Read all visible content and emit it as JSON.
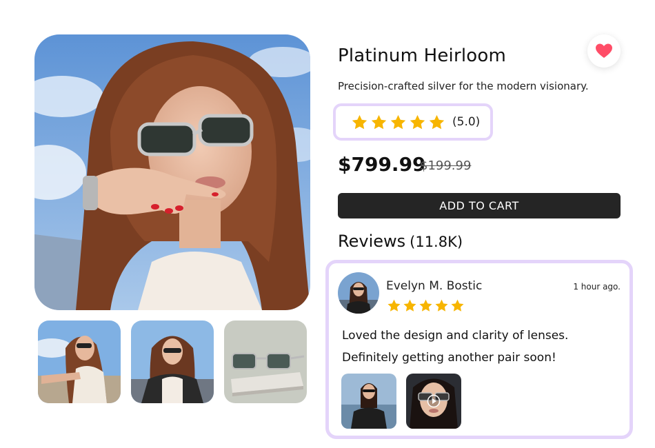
{
  "product": {
    "title": "Platinum Heirloom",
    "subtitle": "Precision-crafted silver for the modern visionary.",
    "rating": 5.0,
    "rating_label": "(5.0)",
    "price": "$799.99",
    "original_price": "$199.99",
    "add_to_cart_label": "ADD TO CART",
    "favorite_icon": "heart-icon"
  },
  "reviews": {
    "heading": "Reviews",
    "count_label": "(11.8K)",
    "items": [
      {
        "name": "Evelyn M. Bostic",
        "time": "1 hour ago.",
        "stars": 5,
        "text_line_1": "Loved the design and clarity of lenses.",
        "text_line_2": "Definitely getting another pair soon!",
        "media_icons": [
          "play-icon"
        ]
      }
    ]
  },
  "colors": {
    "accent_border": "#e4d4fa",
    "star": "#f7b500",
    "heart": "#ff4d67",
    "button_bg": "#252525"
  }
}
